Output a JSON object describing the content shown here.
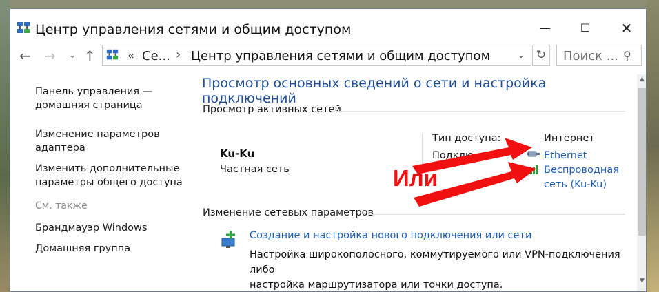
{
  "window": {
    "title": "Центр управления сетями и общим доступом",
    "controls": {
      "minimize": "—",
      "maximize": "☐",
      "close": "✕"
    }
  },
  "address_bar": {
    "overflow_chevron": "«",
    "crumb_short": "Се...",
    "separator": "›",
    "crumb_current": "Центр управления сетями и общим доступом",
    "dropdown": "⌄",
    "refresh": "↻",
    "search_placeholder": "Поиск ...",
    "search_icon": "⚲"
  },
  "nav": {
    "back": "←",
    "forward": "→",
    "recent": "⌄",
    "up": "↑"
  },
  "sidebar": {
    "items": [
      {
        "line1": "Панель управления —",
        "line2": "домашняя страница"
      },
      {
        "line1": "Изменение параметров",
        "line2": "адаптера"
      },
      {
        "line1": "Изменить дополнительные",
        "line2": "параметры общего доступа"
      }
    ],
    "see_also": "См. также",
    "see_also_items": [
      "Брандмауэр Windows",
      "Домашняя группа"
    ]
  },
  "main": {
    "heading": "Просмотр основных сведений о сети и настройка подключений",
    "active_networks_title": "Просмотр активных сетей",
    "network": {
      "name": "Ku-Ku",
      "type": "Частная сеть",
      "access_type_label": "Тип доступа:",
      "access_type_value": "Интернет",
      "connections_label": "Подклю",
      "connection_ethernet": "Ethernet",
      "connection_wireless_line1": "Беспроводная",
      "connection_wireless_line2": "сеть (Ku-Ku)"
    },
    "change_settings_title": "Изменение сетевых параметров",
    "new_connection": {
      "title": "Создание и настройка нового подключения или сети",
      "desc_line1": "Настройка широкополосного, коммутируемого или VPN-подключения либо",
      "desc_line2": "настройка маршрутизатора или точки доступа."
    }
  },
  "annotation": {
    "text": "Или",
    "color": "#f01010"
  },
  "colors": {
    "link": "#1e5fb4",
    "heading": "#1e4d94"
  },
  "scrollbar": {
    "up": "▲",
    "down": "▼"
  }
}
